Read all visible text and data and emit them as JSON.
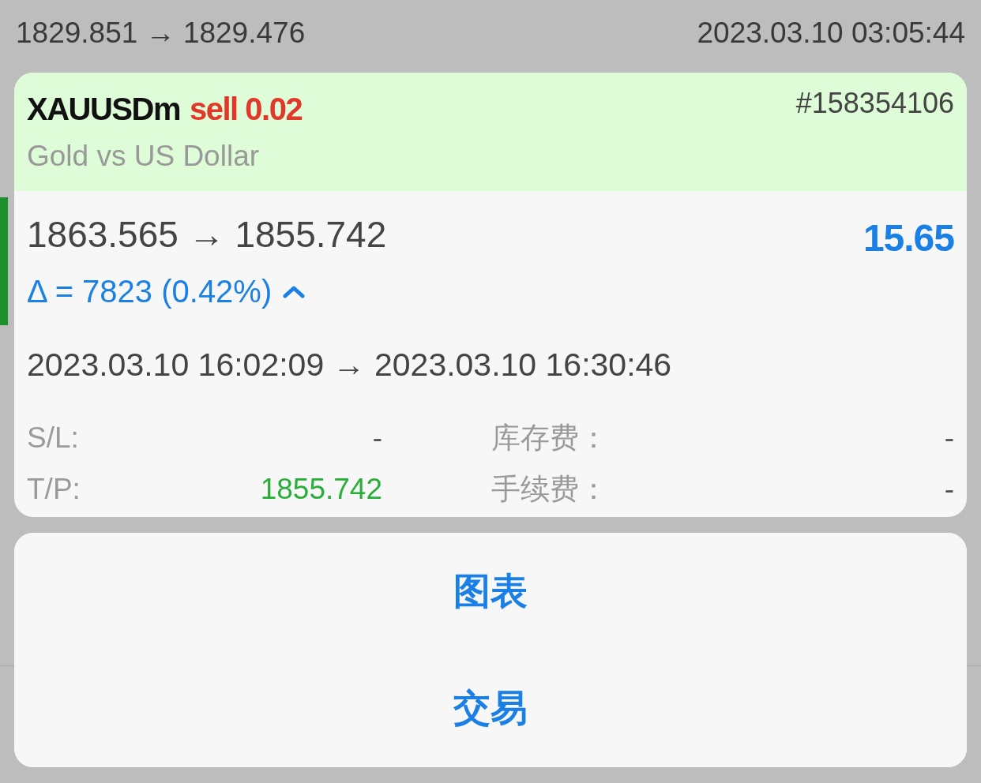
{
  "background": {
    "price_range": "1829.851 → 1829.476",
    "time": "2023.03.10 03:05:44"
  },
  "trade_card": {
    "symbol": "XAUUSDm",
    "order": "sell 0.02",
    "ticket": "#158354106",
    "description": "Gold vs US Dollar",
    "prices": "1863.565 → 1855.742",
    "profit": "15.65",
    "delta": "Δ = 7823 (0.42%)",
    "delta_up": true,
    "times": "2023.03.10 16:02:09 → 2023.03.10 16:30:46",
    "details": [
      {
        "label": "S/L:",
        "value": "-",
        "kind": "plain"
      },
      {
        "label": "库存费：",
        "value": "-",
        "kind": "plain"
      },
      {
        "label": "T/P:",
        "value": "1855.742",
        "kind": "take_profit"
      },
      {
        "label": "手续费：",
        "value": "-",
        "kind": "plain"
      }
    ]
  },
  "action_sheet": {
    "actions": [
      "图表",
      "交易"
    ]
  }
}
